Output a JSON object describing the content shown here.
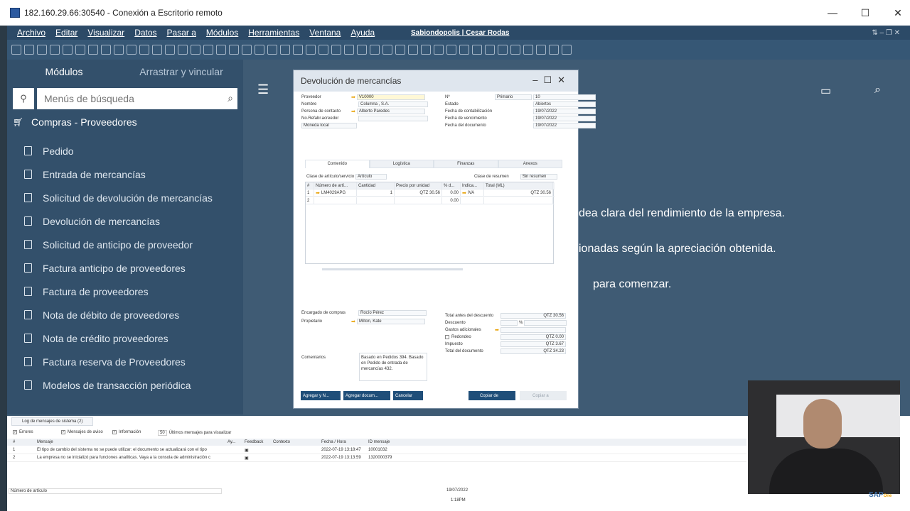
{
  "window": {
    "title": "182.160.29.66:30540 - Conexión a Escritorio remoto"
  },
  "menu": {
    "items": [
      "Archivo",
      "Editar",
      "Visualizar",
      "Datos",
      "Pasar a",
      "Módulos",
      "Herramientas",
      "Ventana",
      "Ayuda"
    ],
    "user": "Sabiondopolis | Cesar Rodas"
  },
  "sidebar": {
    "tab_modules": "Módulos",
    "tab_drag": "Arrastrar y vincular",
    "search_placeholder": "Menús de búsqueda",
    "category": "Compras - Proveedores",
    "items": [
      "Pedido",
      "Entrada de mercancías",
      "Solicitud de devolución de mercancías",
      "Devolución de mercancías",
      "Solicitud de anticipo de proveedor",
      "Factura anticipo de proveedores",
      "Factura de proveedores",
      "Nota de débito de proveedores",
      "Nota de crédito proveedores",
      "Factura reserva de Proveedores",
      "Modelos de transacción periódica"
    ]
  },
  "background": {
    "line1": "dea clara del rendimiento de la empresa.",
    "line2": "ionadas según la apreciación obtenida.",
    "line3": "para comenzar."
  },
  "dialog": {
    "title": "Devolución de mercancías",
    "left_fields": [
      {
        "label": "Proveedor",
        "value": "V10000"
      },
      {
        "label": "Nombre",
        "value": "Columna , S.A."
      },
      {
        "label": "Persona de contacto",
        "value": "Alberto Paredes"
      },
      {
        "label": "No.Refabr.acreedor",
        "value": ""
      },
      {
        "label": "Moneda local",
        "value": ""
      }
    ],
    "right_fields": [
      {
        "label": "Nº",
        "value": "Primario",
        "value2": "10"
      },
      {
        "label": "Estado",
        "value": "Abiertos"
      },
      {
        "label": "Fecha de contabilización",
        "value": "19/07/2022"
      },
      {
        "label": "Fecha de vencimiento",
        "value": "19/07/2022"
      },
      {
        "label": "Fecha del documento",
        "value": "19/07/2022"
      }
    ],
    "tabs": [
      "Contenido",
      "Logística",
      "Finanzas",
      "Anexos"
    ],
    "item_class_label": "Clase de artículo/servicio",
    "item_class_value": "Artículo",
    "summary_label": "Clase de resumen",
    "summary_value": "Sin resumen",
    "grid_headers": [
      "#",
      "Número de artí...",
      "Cantidad",
      "Precio por unidad",
      "% d...",
      "Indica...",
      "Total (ML)"
    ],
    "grid_rows": [
      [
        "1",
        "LM4029APG",
        "1",
        "QTZ 30.56",
        "0.00",
        "IVA",
        "QTZ 30.56"
      ],
      [
        "2",
        "",
        "",
        "",
        "0.00",
        "",
        ""
      ]
    ],
    "buyer_label": "Encargado de compras",
    "buyer_value": "Rocío Pérez",
    "owner_label": "Propietario",
    "owner_value": "Milton, Kate",
    "comments_label": "Comentarios",
    "comments_value": "Basado en Pedidos 394. Basado en Pedido de entrada de mercancías 432.",
    "totals": [
      {
        "label": "Total antes del descuento",
        "value": "QTZ 30.56"
      },
      {
        "label": "Descuento",
        "value": ""
      },
      {
        "label": "Gastos adicionales",
        "value": ""
      },
      {
        "label": "Redondeo",
        "value": "QTZ 0.00"
      },
      {
        "label": "Impuesto",
        "value": "QTZ 3.67"
      },
      {
        "label": "Total del documento",
        "value": "QTZ 34.23"
      }
    ],
    "buttons": [
      "Agregar y N...",
      "Agregar docum...",
      "Cancelar",
      "Copiar de",
      "Copiar a"
    ]
  },
  "log": {
    "tab": "Log de mensajes de sistema (2)",
    "filters": [
      "Errores",
      "Mensajes de aviso",
      "Información"
    ],
    "count": "50",
    "count_label": "Últimos mensajes para visualizar",
    "headers": [
      "#",
      "Mensaje",
      "Ay...",
      "Feedback",
      "Contexto",
      "Fecha / Hora",
      "ID mensaje"
    ],
    "rows": [
      [
        "1",
        "El tipo de cambio del sistema no se puede utilizar: el documento se actualizará con el tipo",
        "2022-07-19 13:18:47",
        "10001032"
      ],
      [
        "2",
        "La empresa no se inicializó para funciones analíticas. Vaya a la consola de administración c",
        "2022-07-19 13:13:59",
        "1320000379"
      ]
    ]
  },
  "status": {
    "field": "Número de artículo",
    "date": "19/07/2022",
    "time": "1:18PM"
  },
  "sap_logo": "SAP One"
}
